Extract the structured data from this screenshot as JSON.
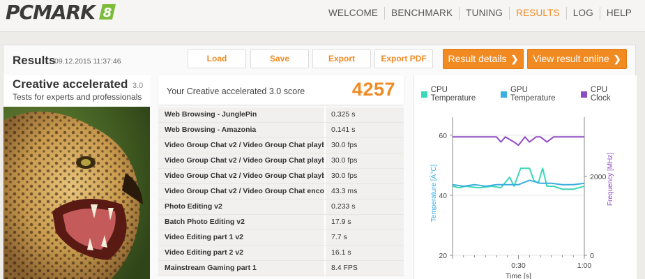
{
  "nav": {
    "logo_text": "PCMARK",
    "logo_badge": "8",
    "items": [
      "WELCOME",
      "BENCHMARK",
      "TUNING",
      "RESULTS",
      "LOG",
      "HELP"
    ],
    "active": "RESULTS"
  },
  "header": {
    "title": "Results",
    "date": "09.12.2015 11:37:46",
    "buttons": {
      "load": "Load",
      "save": "Save",
      "export": "Export",
      "export_pdf": "Export PDF",
      "result_details": "Result details",
      "view_online": "View result online"
    }
  },
  "benchmark": {
    "name": "Creative accelerated",
    "version": "3.0",
    "description": "Tests for experts and professionals",
    "image": "leopard-photo"
  },
  "score": {
    "label": "Your Creative accelerated 3.0 score",
    "value": "4257"
  },
  "tests": [
    {
      "name": "Web Browsing - JunglePin",
      "value": "0.325 s"
    },
    {
      "name": "Web Browsing - Amazonia",
      "value": "0.141 s"
    },
    {
      "name": "Video Group Chat v2 / Video Group Chat playb",
      "value": "30.0 fps"
    },
    {
      "name": "Video Group Chat v2 / Video Group Chat playb",
      "value": "30.0 fps"
    },
    {
      "name": "Video Group Chat v2 / Video Group Chat playb",
      "value": "30.0 fps"
    },
    {
      "name": "Video Group Chat v2 / Video Group Chat enco",
      "value": "43.3 ms"
    },
    {
      "name": "Photo Editing v2",
      "value": "0.233 s"
    },
    {
      "name": "Batch Photo Editing v2",
      "value": "17.9 s"
    },
    {
      "name": "Video Editing part 1 v2",
      "value": "7.7 s"
    },
    {
      "name": "Video Editing part 2 v2",
      "value": "16.1 s"
    },
    {
      "name": "Mainstream Gaming part 1",
      "value": "8.4 FPS"
    }
  ],
  "chart_data": {
    "type": "line",
    "legend": [
      "CPU Temperature",
      "GPU Temperature",
      "CPU Clock"
    ],
    "colors": {
      "cpu_temp": "#3ad8b8",
      "gpu_temp": "#3aaee0",
      "cpu_clock": "#8e4cc4"
    },
    "xlabel": "Time [s]",
    "ylabel_left": "Temperature [Â°C]",
    "ylabel_right": "Frequency [MHz]",
    "x_ticks": [
      "0:30",
      "1:00"
    ],
    "x_tick_values": [
      30,
      60
    ],
    "y_left_ticks": [
      20,
      40,
      60
    ],
    "y_right_ticks": [
      0,
      2000
    ],
    "xlim": [
      0,
      60
    ],
    "ylim_left": [
      20,
      66
    ],
    "ylim_right": [
      0,
      3500
    ],
    "series": [
      {
        "name": "CPU Temperature",
        "axis": "left",
        "x": [
          0,
          3,
          6,
          12,
          18,
          22,
          26,
          28,
          31,
          35,
          37,
          39,
          41,
          43,
          46,
          50,
          55,
          60
        ],
        "y": [
          43,
          42.5,
          43,
          42.5,
          43,
          42.5,
          46,
          43,
          49,
          49,
          45,
          44,
          49,
          43,
          43,
          42,
          42,
          43
        ]
      },
      {
        "name": "GPU Temperature",
        "axis": "left",
        "x": [
          0,
          5,
          10,
          15,
          20,
          25,
          30,
          35,
          40,
          45,
          50,
          55,
          60
        ],
        "y": [
          43.5,
          43,
          43.5,
          43,
          43.5,
          43.5,
          43.5,
          45,
          44,
          44,
          43.5,
          43.5,
          44
        ]
      },
      {
        "name": "CPU Clock",
        "axis": "right",
        "x": [
          0,
          5,
          10,
          15,
          20,
          22,
          24,
          28,
          30,
          33,
          35,
          38,
          40,
          43,
          46,
          48,
          52,
          56,
          60
        ],
        "y": [
          3000,
          3000,
          3000,
          3000,
          3000,
          2870,
          3000,
          2870,
          2790,
          3000,
          2870,
          3000,
          3000,
          2870,
          3000,
          3000,
          3000,
          3000,
          3000
        ]
      }
    ]
  }
}
